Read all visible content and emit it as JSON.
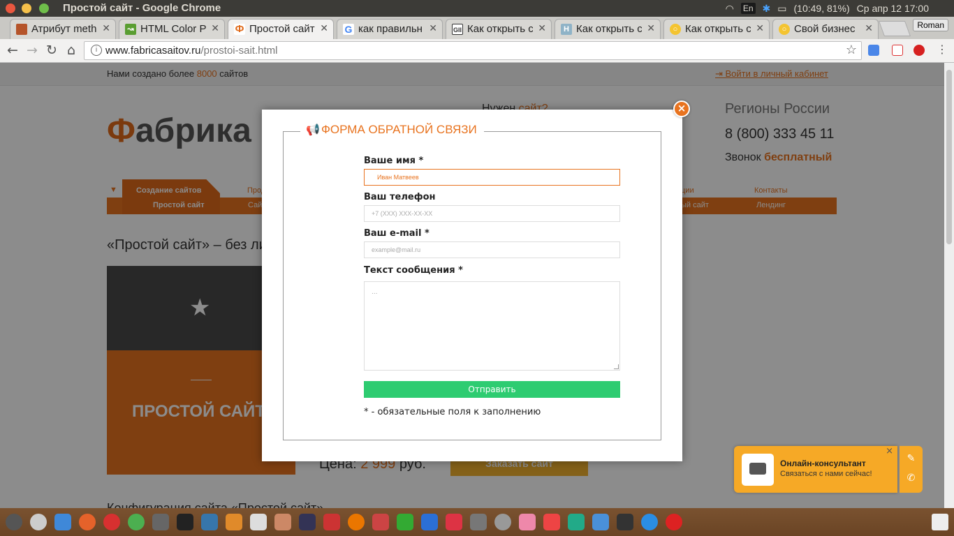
{
  "window": {
    "title": "Простой сайт - Google Chrome"
  },
  "tray": {
    "lang": "En",
    "battery": "(10:49, 81%)",
    "datetime": "Ср апр 12 17:00"
  },
  "tabs": [
    {
      "label": "Атрибут meth"
    },
    {
      "label": "HTML Color P"
    },
    {
      "label": "Простой сайт"
    },
    {
      "label": "как правильн"
    },
    {
      "label": "Как открыть с"
    },
    {
      "label": "Как открыть с"
    },
    {
      "label": "Как открыть с"
    },
    {
      "label": "Свой бизнес"
    }
  ],
  "profile": "Roman",
  "address": {
    "domain": "www.fabricasaitov.ru",
    "path": "/prostoi-sait.html"
  },
  "site": {
    "topline_prefix": "Нами создано более",
    "topline_count": "8000",
    "topline_suffix": "сайтов",
    "login": "Войти в личный кабинет",
    "logo_f": "Ф",
    "logo_rest": "абрика",
    "need_prefix": "Нужен",
    "need_link": "сайт?",
    "regions": "Регионы России",
    "phone": "8 (800) 333 45 11",
    "call_prefix": "Звонок",
    "call_free": "бесплатный",
    "menu_top": [
      "Создание сайтов",
      "Прод",
      "ции",
      "Контакты"
    ],
    "menu_bottom": [
      "Простой сайт",
      "Сай",
      "ый сайт",
      "Лендинг"
    ],
    "headline": "«Простой сайт» – без ли",
    "hero_title": "ПРОСТОЙ САЙТ",
    "price_prefix": "Цена:",
    "price_value": "2 999",
    "price_suffix": "руб.",
    "order": "Заказать сайт",
    "bottom_text": "Конфигурация сайта «Простой сайт»"
  },
  "modal": {
    "title": "ФОРМА ОБРАТНОЙ СВЯЗИ",
    "name_label": "Ваше имя *",
    "name_placeholder": "Иван Матвеев",
    "phone_label": "Ваш телефон",
    "phone_placeholder": "+7 (XXX) XXX-XX-XX",
    "email_label": "Ваш e-mail *",
    "email_placeholder": "example@mail.ru",
    "message_label": "Текст сообщения *",
    "message_placeholder": "...",
    "submit": "Отправить",
    "required_note": "* - обязательные поля к заполнению"
  },
  "consultant": {
    "title": "Онлайн-консультант",
    "subtitle": "Связаться с нами сейчас!"
  },
  "colors": {
    "accent": "#e8731f",
    "submit": "#2ecc71",
    "consultant": "#f6a926"
  }
}
